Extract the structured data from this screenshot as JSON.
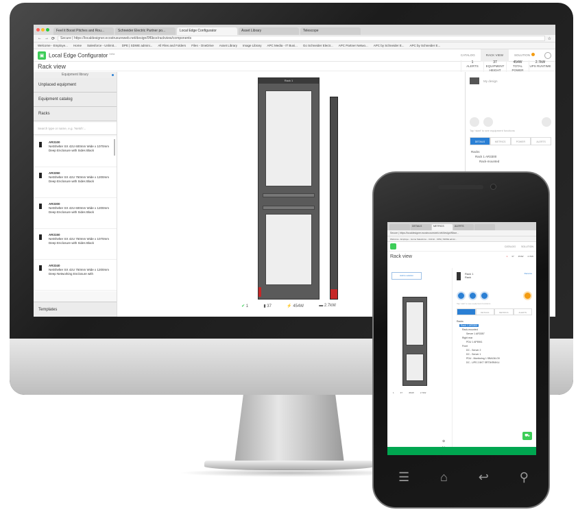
{
  "desktop": {
    "browser": {
      "tabs": [
        "Feel it Boost Pitches and Rou...",
        "Schneider Electric Partner po...",
        "Local Edge Configurator",
        "Asset Library",
        "Telescope"
      ],
      "active_tab": 2,
      "url": "Secure | https://localdesigner.ecostruxureweb.net/design/0f6bce/rackview/components",
      "bookmarks": [
        "Welcome - Employe...",
        "Home",
        "Salesforce - Unlimit...",
        "DPE | SDWE admini...",
        "All Files and Folders",
        "Files - OneDrive",
        "Asset Library",
        "Image Library",
        "APC Media - IT Busi...",
        "Go Schneider Electr...",
        "APC Partner Netwo...",
        "APC by Schneider E...",
        "APC by Schneider E..."
      ]
    },
    "app": {
      "title": "Local Edge Configurator",
      "title_sup": "beta",
      "nav": [
        "CATALOG",
        "RACK VIEW",
        "SOLUTION"
      ]
    },
    "page_title": "Rack view",
    "stats": [
      {
        "n": "1",
        "label": "ALERTS"
      },
      {
        "n": "37",
        "label": "EQUIPMENT HEIGHT"
      },
      {
        "n": "454W",
        "label": "TOTAL POWER"
      },
      {
        "n": "2.7kW",
        "label": "UPS RUNTIME"
      }
    ],
    "sidebar": {
      "header": "Equipment library",
      "items": [
        "Unplaced equipment",
        "Equipment catalog",
        "Racks"
      ],
      "search_placeholder": "Search type or name, e.g. 'Netsh'...",
      "entries": [
        {
          "code": "AR3100",
          "desc": "NetShelter SX 42U 600mm Wide x 1070mm Deep Enclosure with Sides Black"
        },
        {
          "code": "AR3350",
          "desc": "NetShelter SX 42U 750mm Wide x 1200mm Deep Enclosure with Sides Black"
        },
        {
          "code": "AR3300",
          "desc": "NetShelter SX 42U 600mm Wide x 1200mm Deep Enclosure with Sides Black"
        },
        {
          "code": "AR3150",
          "desc": "NetShelter SX 42U 750mm Wide x 1070mm Deep Enclosure with Sides Black"
        },
        {
          "code": "AR3340",
          "desc": "NetShelter SX 42U 750mm Wide x 1200mm Deep Networking Enclosure with"
        }
      ],
      "templates": "Templates"
    },
    "canvas": {
      "rack_label": "Rack 1",
      "stats": [
        "1",
        "37",
        "454W",
        "2.7kW"
      ]
    },
    "right_panel": {
      "card_text": "My design",
      "hint": "Tap 'start' to see equipment functions",
      "tabs": [
        "DETAILS",
        "METRICS",
        "POWER",
        "ALERTS"
      ],
      "tree": [
        "Racks",
        "Rack 1 AR3300",
        "Rack-mounted"
      ]
    }
  },
  "phone": {
    "tabs": [
      "",
      "DETAILS",
      "METRICS",
      "ALERTS"
    ],
    "url": "Secure | https://localdesigner.ecostruxureweb.net/design/f6bce...",
    "bookmarks": "Welcome - Employe...  Home  Salesforce - Unlimit...  DPE | SDWE admin...",
    "nav": [
      "CATALOG",
      "SOLUTION"
    ],
    "page_title": "Rack view",
    "stats": [
      "1",
      "37",
      "454W",
      "2.7kW"
    ],
    "add_button": "Add to solution",
    "card_title": "Rack 1",
    "card_sub": "Rack",
    "card_link": "Rename",
    "hint": "Tap 'start' to see equipment functions",
    "tree": [
      "Racks",
      "Rack 1 AR3300",
      "Rack-mounted",
      "Server 1 AR3357",
      "Right rear",
      "PDU 1 AP8941",
      "Front",
      "DC - Server 2",
      "DC - Server 1",
      "PDU - Monitoring 1 SBAC6LO0",
      "DC - UPS 2.5KT SRT3KRMXLI"
    ],
    "canvas_stats": [
      "1",
      "37",
      "454W",
      "2.7kW"
    ]
  },
  "colors": {
    "accent_green": "#3dcd58",
    "accent_blue": "#2a7fd4",
    "alert_orange": "#f39c12",
    "alert_red": "#c62828"
  }
}
